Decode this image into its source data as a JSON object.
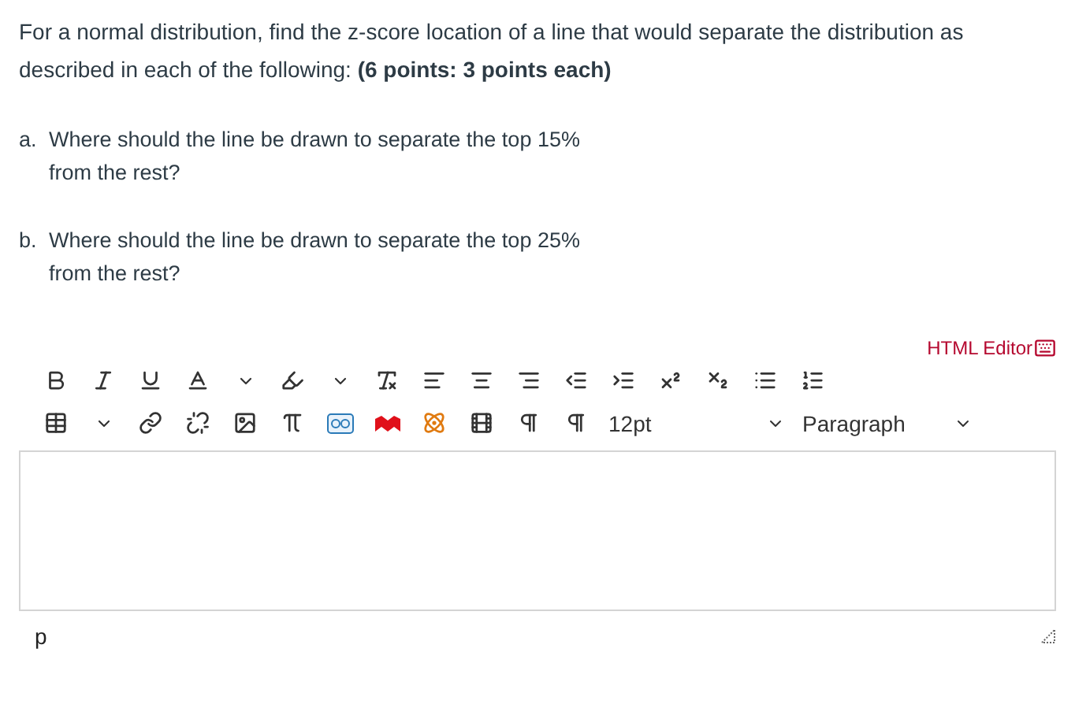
{
  "prompt": "For a normal distribution, find the z-score location of a line that would separate the distribution as described in each of the following: **(6 points: 3 points each)**",
  "questions": [
    {
      "label": "a.",
      "lines": [
        "Where should the line be drawn to separate the top 15%",
        "from the rest?"
      ]
    },
    {
      "label": "b.",
      "lines": [
        "Where should the line be drawn to separate the top 25%",
        "from the rest?"
      ]
    }
  ],
  "editor": {
    "html_editor_link": "HTML Editor",
    "font_size": "12pt",
    "block_format": "Paragraph",
    "path": "p"
  }
}
